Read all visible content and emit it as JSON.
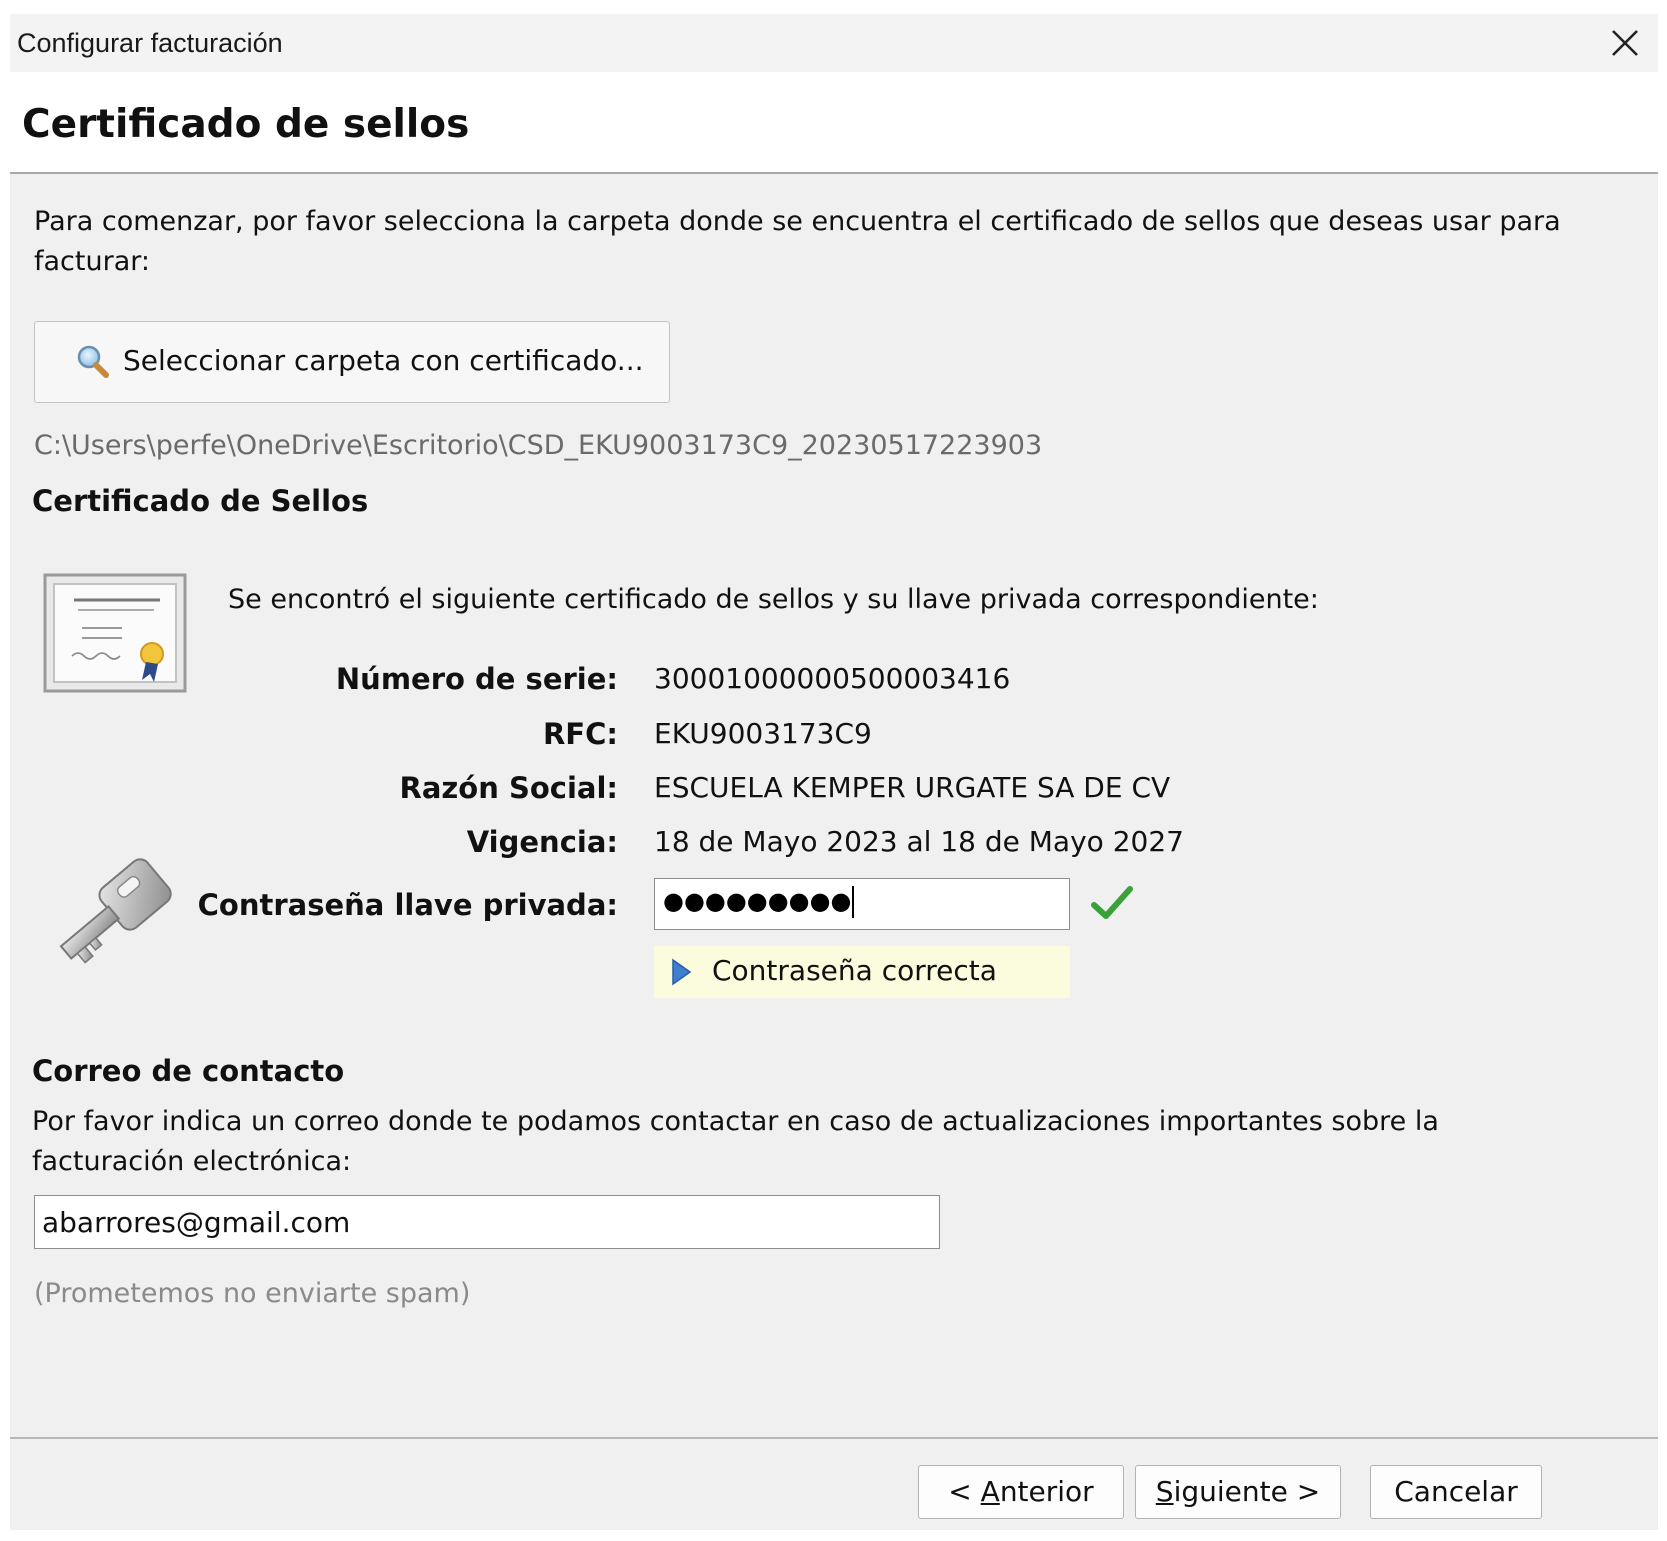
{
  "window": {
    "title": "Configurar facturación"
  },
  "header": {
    "title": "Certificado de sellos"
  },
  "intro": {
    "text": "Para comenzar, por favor selecciona la carpeta donde se encuentra el certificado de sellos que deseas usar para facturar:"
  },
  "select_folder": {
    "label": "Seleccionar carpeta con certificado...",
    "icon": "search-icon"
  },
  "selected_path": "C:\\Users\\perfe\\OneDrive\\Escritorio\\CSD_EKU9003173C9_20230517223903",
  "certificate": {
    "section_title": "Certificado de Sellos",
    "found_text": "Se encontró el siguiente certificado de sellos y su llave privada correspondiente:",
    "serial_label": "Número de serie:",
    "serial_value": "30001000000500003416",
    "rfc_label": "RFC:",
    "rfc_value": "EKU9003173C9",
    "razon_label": "Razón Social:",
    "razon_value": "ESCUELA KEMPER URGATE SA DE CV",
    "vigencia_label": "Vigencia:",
    "vigencia_value": "18 de Mayo 2023 al 18 de Mayo 2027",
    "password_label": "Contraseña llave privada:",
    "password_value": "●●●●●●●●●",
    "password_status": "Contraseña correcta",
    "status_color": "#3aa03a",
    "icons": [
      "certificate-icon",
      "key-icon",
      "check-icon"
    ]
  },
  "contact": {
    "section_title": "Correo de contacto",
    "description": "Por favor indica un correo donde te podamos contactar en caso de actualizaciones importantes sobre la facturación electrónica:",
    "email_value": "abarrores@gmail.com",
    "spam_note": "(Prometemos no enviarte spam)"
  },
  "footer": {
    "back_prefix": "< ",
    "back_mnemonic": "A",
    "back_rest": "nterior",
    "next_mnemonic": "S",
    "next_rest": "iguiente >",
    "cancel_label": "Cancelar"
  }
}
